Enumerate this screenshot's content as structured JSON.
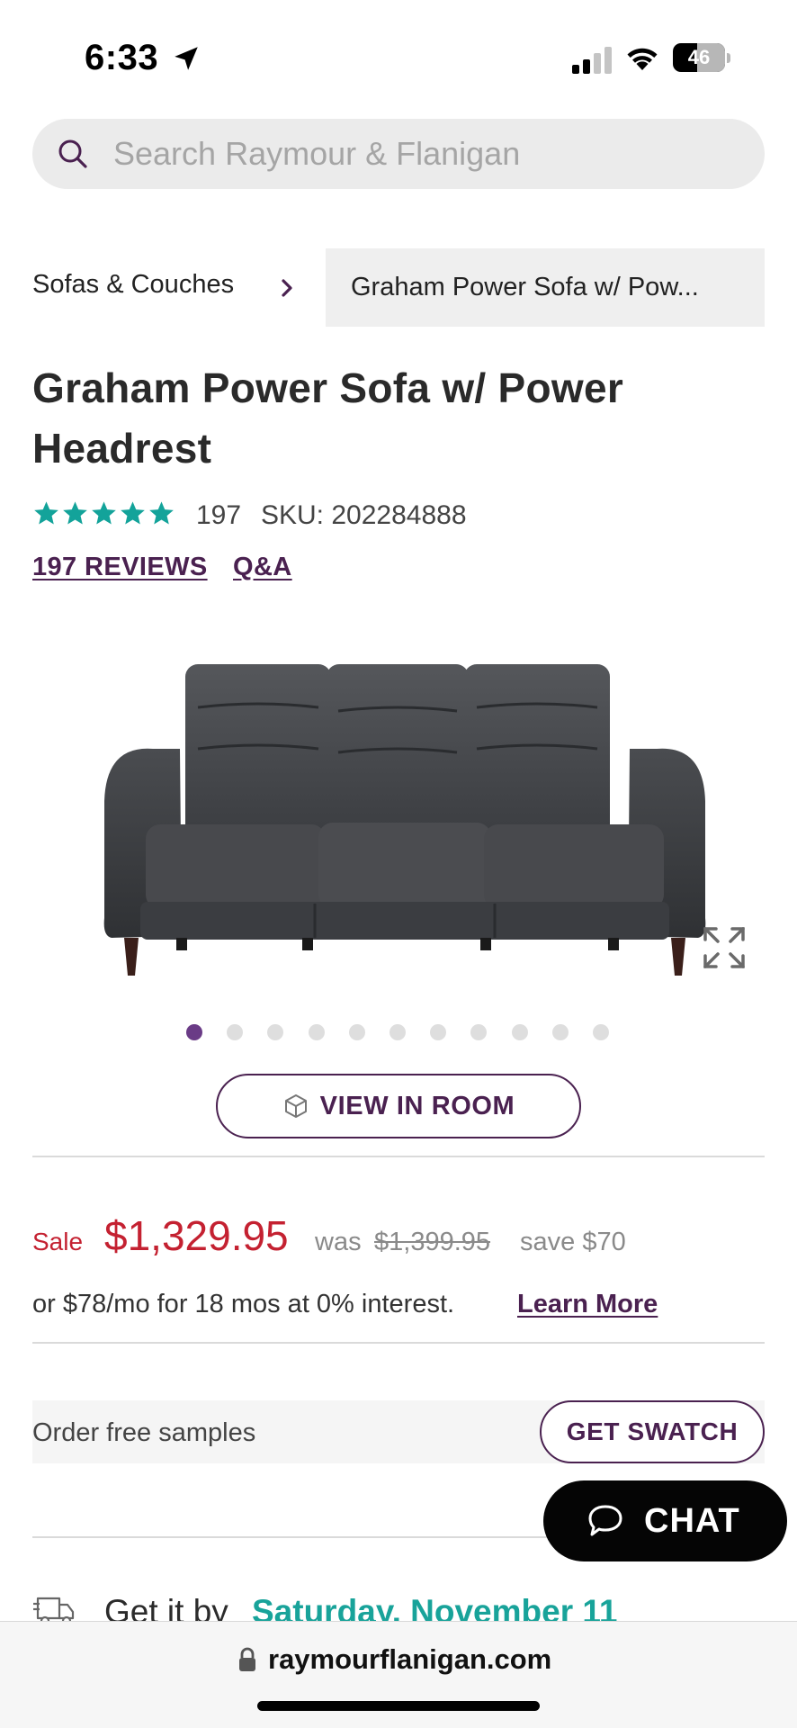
{
  "status_bar": {
    "time": "6:33",
    "battery": "46",
    "battery_level_percent": 46
  },
  "search": {
    "placeholder": "Search Raymour & Flanigan"
  },
  "breadcrumb": {
    "items": [
      "Sofas & Couches",
      "Graham Power Sofa w/ Pow..."
    ]
  },
  "product": {
    "title": "Graham Power Sofa w/ Power Headrest",
    "rating_stars": 5,
    "rating_count": "197",
    "sku": "SKU: 202284888",
    "reviews_link": "197 REVIEWS",
    "qa_link": "Q&A",
    "image_alt": "Dark gray leather power sofa",
    "carousel": {
      "total": 11,
      "active_index": 0
    },
    "view_in_room": "VIEW IN ROOM"
  },
  "price": {
    "sale_label": "Sale",
    "sale_price": "$1,329.95",
    "was_label": "was",
    "was_price": "$1,399.95",
    "save": "save $70",
    "financing": "or $78/mo for 18 mos at 0% interest.",
    "learn_more": "Learn More"
  },
  "samples": {
    "text": "Order free samples",
    "button": "GET SWATCH"
  },
  "chat": {
    "label": "CHAT"
  },
  "delivery": {
    "prefix": "Get it by",
    "date": "Saturday, November 11"
  },
  "browser": {
    "url": "raymourflanigan.com"
  },
  "colors": {
    "brand_purple": "#4a2150",
    "sale_red": "#c42131",
    "star_teal": "#13a39a",
    "delivery_teal": "#18a39a",
    "dot_active": "#6a3b86"
  }
}
